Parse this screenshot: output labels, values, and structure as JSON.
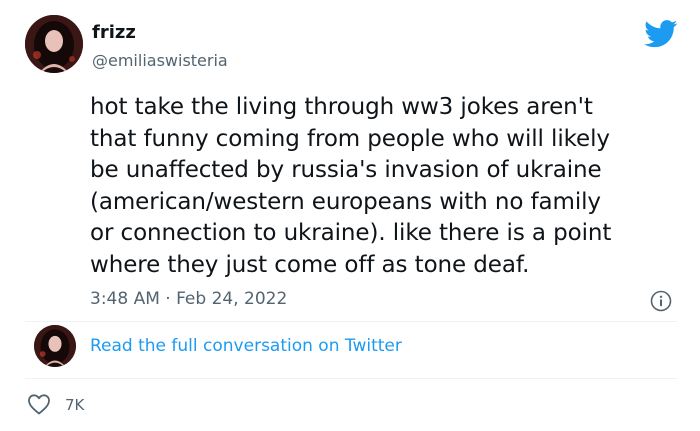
{
  "user": {
    "display_name": "frizz",
    "handle": "@emiliaswisteria"
  },
  "tweet": {
    "lines": [
      "hot take the living through ww3 jokes aren't",
      "that funny coming from people who will likely",
      "be unaffected by russia's invasion of ukraine",
      "(american/western europeans with no family",
      "or connection to ukraine). like there is a point",
      "where they just come off as tone deaf."
    ],
    "timestamp": "3:48 AM · Feb 24, 2022"
  },
  "footer": {
    "read_link": "Read the full conversation on Twitter",
    "like_count": "7K"
  },
  "icons": {
    "brand": "twitter-bird-icon",
    "info": "info-icon",
    "like": "heart-outline-icon"
  },
  "colors": {
    "brand_blue": "#1d9bf0",
    "text_primary": "#0f1419",
    "text_secondary": "#536471"
  }
}
